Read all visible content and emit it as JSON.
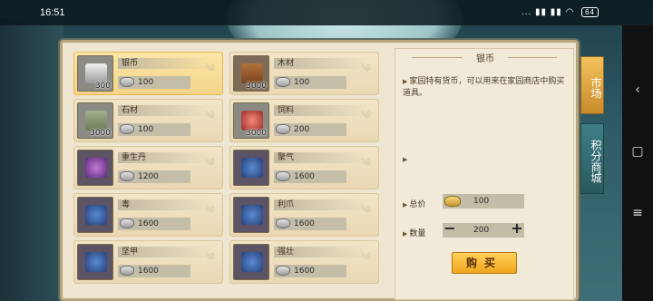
{
  "status_bar": {
    "time": "16:51",
    "indicators": "... ▮▮ ▮▮ ◠",
    "battery": "64"
  },
  "tabs": [
    {
      "label": "市场",
      "active": true
    },
    {
      "label": "积分商城",
      "active": false
    }
  ],
  "items": [
    {
      "name": "银币",
      "price": "100",
      "qty": "300",
      "icon": "silver-ingot-icon",
      "selected": true
    },
    {
      "name": "木材",
      "price": "100",
      "qty": "3000",
      "icon": "wood-logs-icon",
      "selected": false
    },
    {
      "name": "石材",
      "price": "100",
      "qty": "3000",
      "icon": "stone-blocks-icon",
      "selected": false
    },
    {
      "name": "饲料",
      "price": "200",
      "qty": "3000",
      "icon": "feed-ball-icon",
      "selected": false
    },
    {
      "name": "重生丹",
      "price": "1200",
      "qty": "",
      "icon": "rebirth-pill-icon",
      "selected": false
    },
    {
      "name": "聚气",
      "price": "1600",
      "qty": "",
      "icon": "scroll-icon",
      "selected": false
    },
    {
      "name": "毒",
      "price": "1600",
      "qty": "",
      "icon": "scroll-icon",
      "selected": false
    },
    {
      "name": "利爪",
      "price": "1600",
      "qty": "",
      "icon": "scroll-icon",
      "selected": false
    },
    {
      "name": "坚甲",
      "price": "1600",
      "qty": "",
      "icon": "scroll-icon",
      "selected": false
    },
    {
      "name": "强壮",
      "price": "1600",
      "qty": "",
      "icon": "scroll-icon",
      "selected": false
    }
  ],
  "detail": {
    "title": "银币",
    "description": "家园特有货币，可以用来在家园商店中购买道具。",
    "total_label": "总价",
    "total_value": "100",
    "quantity_label": "数量",
    "quantity_value": "200",
    "buy_label": "购买"
  },
  "colors": {
    "accent": "#f0a51e",
    "panel_bg": "#efe6d2",
    "tab_inactive": "#2a5a60"
  }
}
